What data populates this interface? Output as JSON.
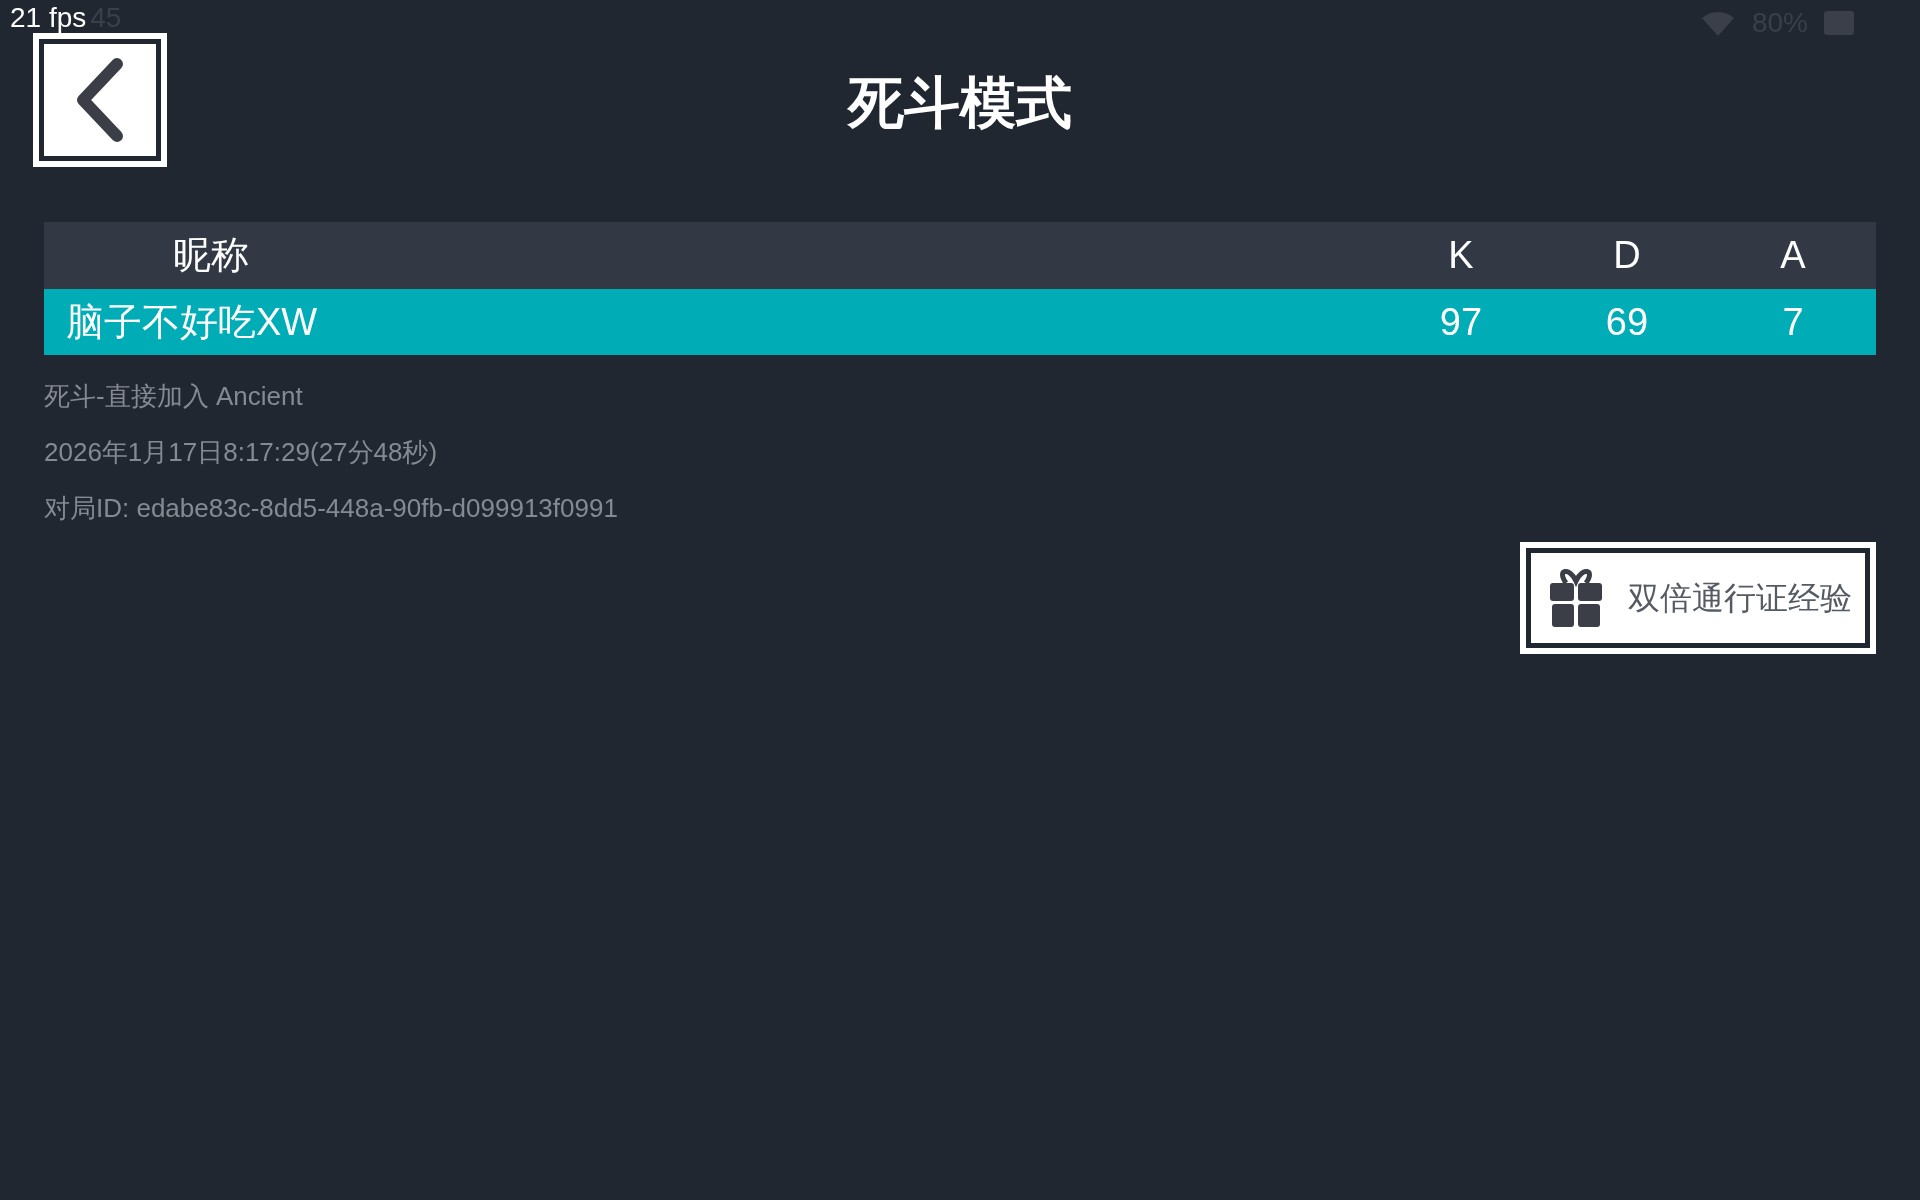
{
  "overlay": {
    "fps": "21 fps"
  },
  "status_bar": {
    "time": "45",
    "battery": "80%"
  },
  "title": "死斗模式",
  "table": {
    "columns": [
      "昵称",
      "K",
      "D",
      "A"
    ],
    "rows": [
      {
        "name": "脑子不好吃XW",
        "k": "97",
        "d": "69",
        "a": "7",
        "selected": true
      }
    ]
  },
  "info": [
    "死斗-直接加入 Ancient",
    "2026年1月17日8:17:29(27分48秒)",
    "对局ID: edabe83c-8dd5-448a-90fb-d099913f0991"
  ],
  "reward_button": {
    "label": "双倍通行证经验"
  }
}
